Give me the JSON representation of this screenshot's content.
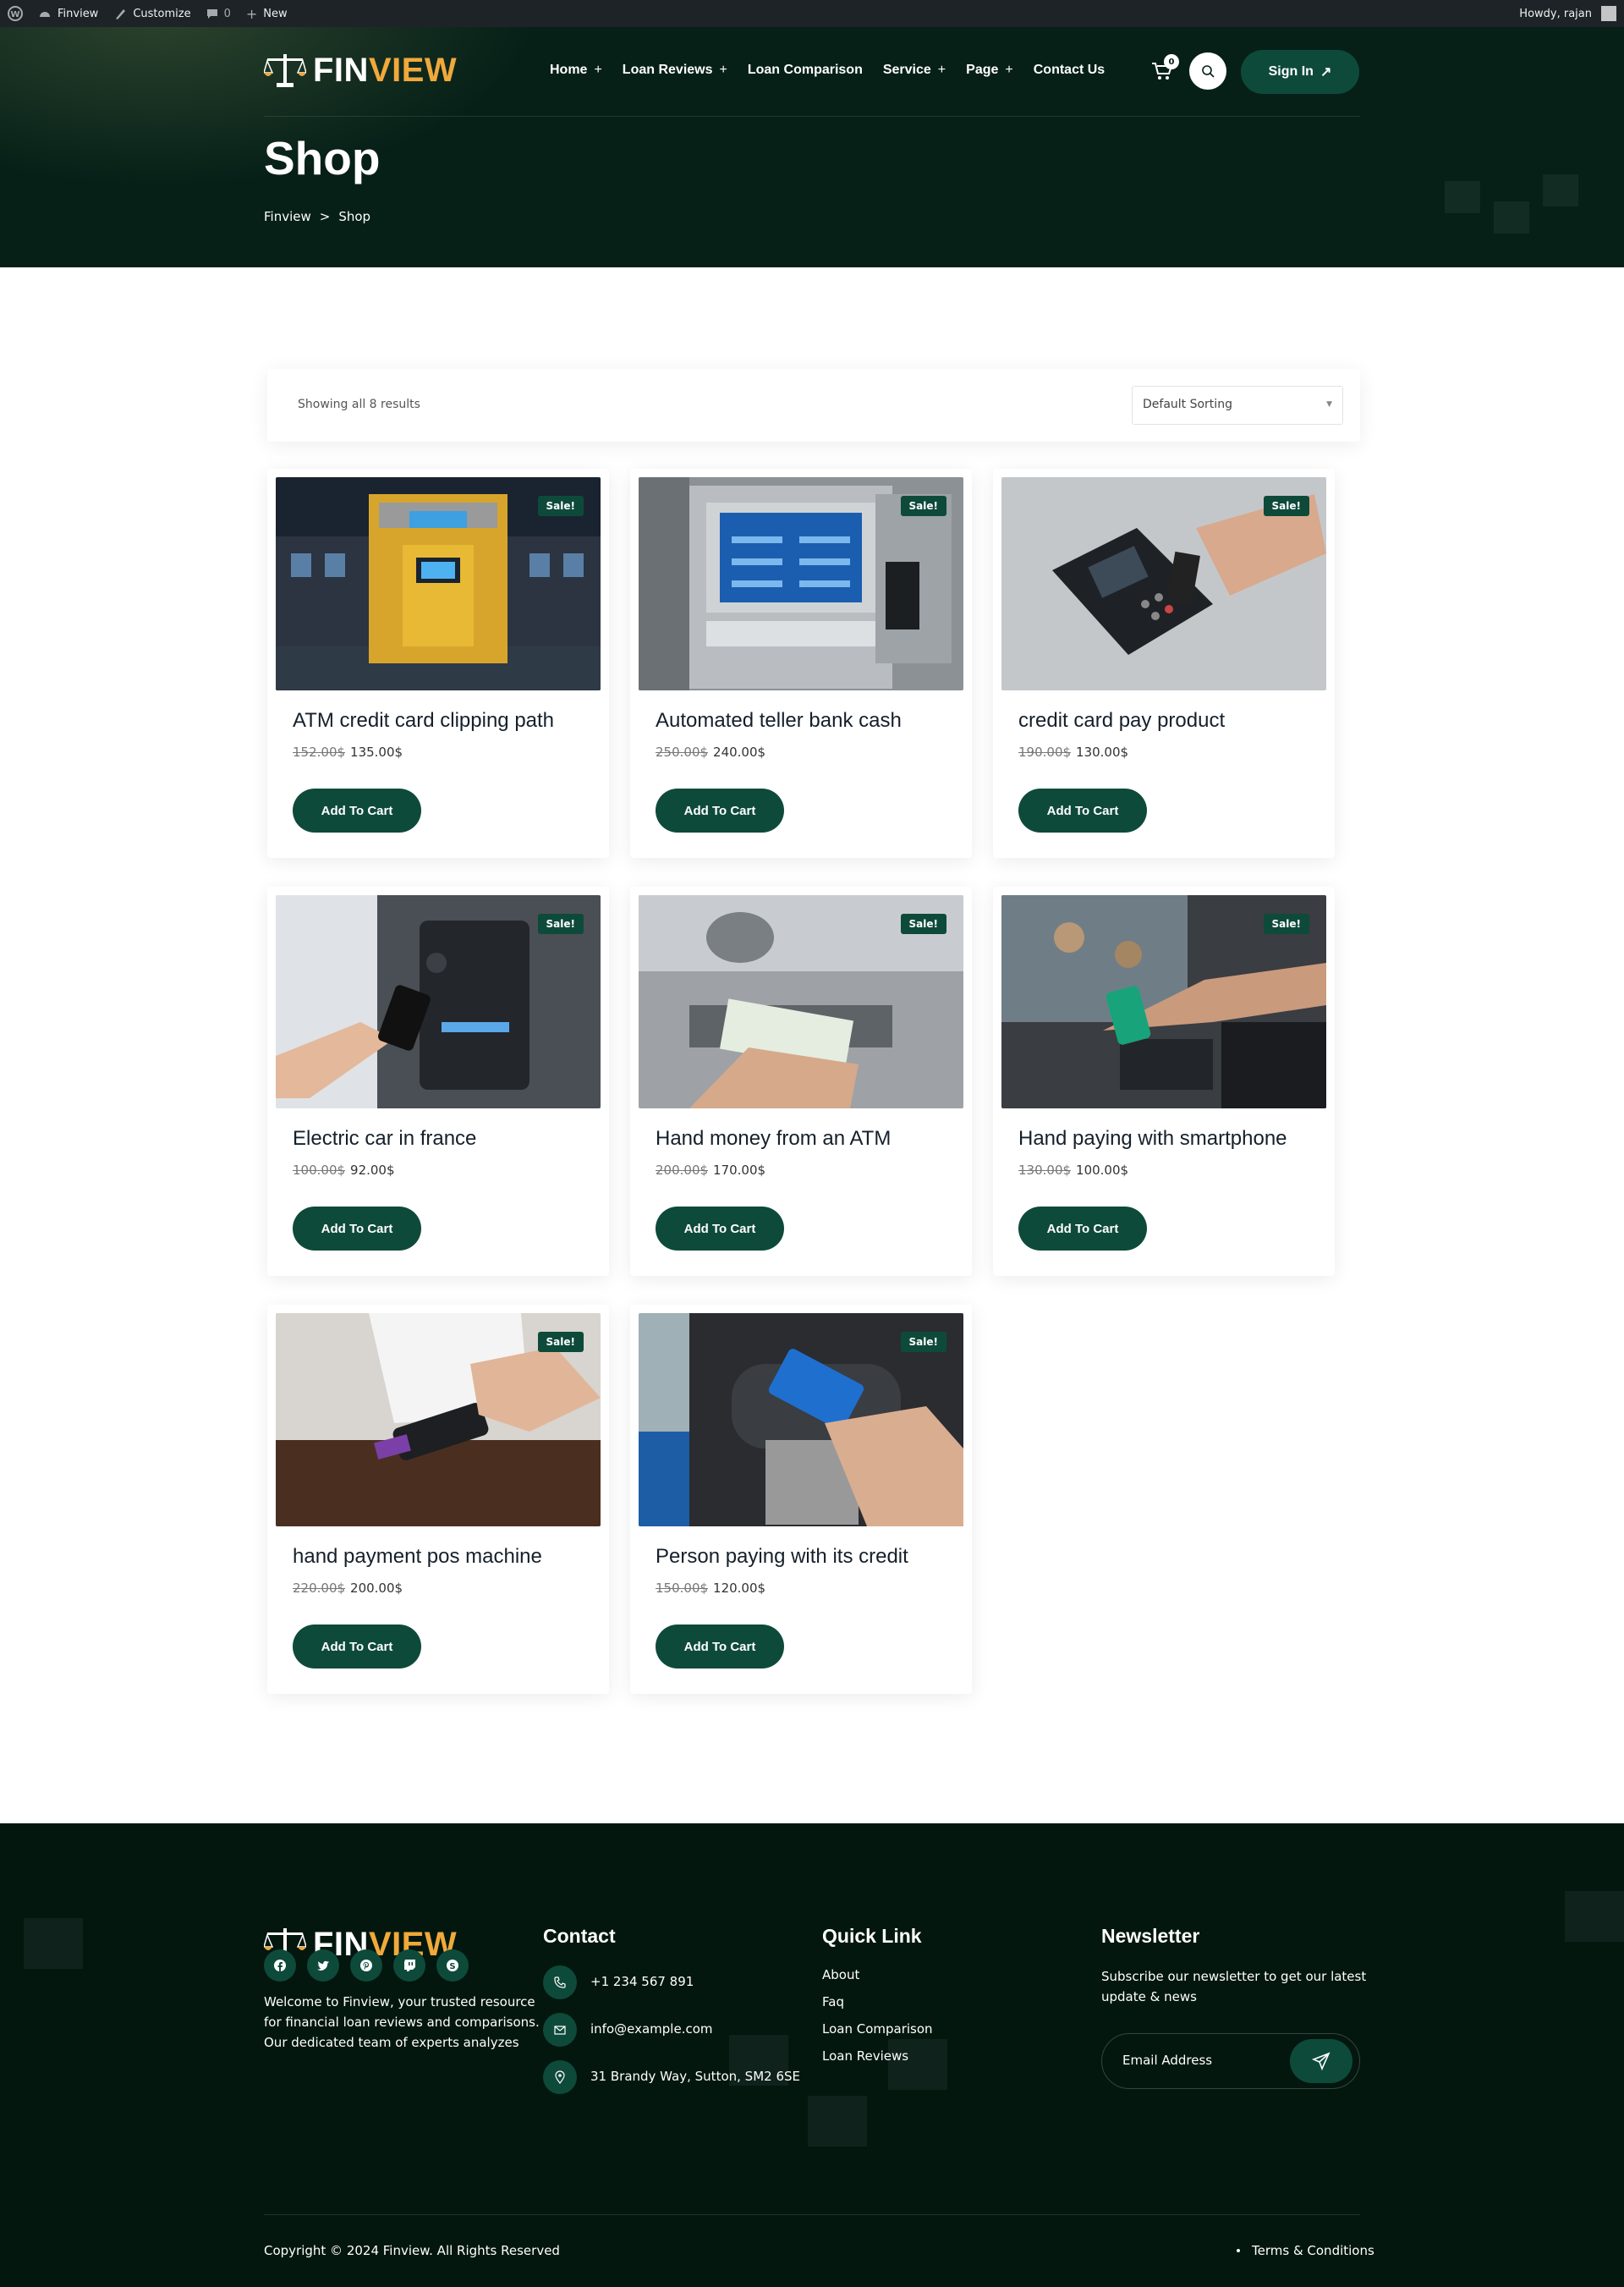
{
  "admin_bar": {
    "site_name": "Finview",
    "customize_label": "Customize",
    "comments_count": "0",
    "new_label": "New",
    "greeting": "Howdy, rajan"
  },
  "header": {
    "logo_part1": "FIN",
    "logo_part2": "VIEW",
    "nav": [
      {
        "label": "Home",
        "plus": "+"
      },
      {
        "label": "Loan Reviews",
        "plus": "+"
      },
      {
        "label": "Loan Comparison",
        "plus": ""
      },
      {
        "label": "Service",
        "plus": "+"
      },
      {
        "label": "Page",
        "plus": "+"
      },
      {
        "label": "Contact Us",
        "plus": ""
      }
    ],
    "cart_count": "0",
    "signin_label": "Sign In",
    "signin_arrow": "↗"
  },
  "hero": {
    "title": "Shop",
    "breadcrumb_home": "Finview",
    "breadcrumb_sep": ">",
    "breadcrumb_current": "Shop"
  },
  "shop": {
    "results_text": "Showing all 8 results",
    "sorting_value": "Default Sorting",
    "sale_badge": "Sale!",
    "add_to_cart_label": "Add To Cart",
    "products": [
      {
        "name": "ATM credit card clipping path",
        "old_price": "152.00$",
        "price": "135.00$",
        "image": "atm-yellow-kiosk"
      },
      {
        "name": "Automated teller bank cash",
        "old_price": "250.00$",
        "price": "240.00$",
        "image": "atm-screen-closeup"
      },
      {
        "name": "credit card pay product",
        "old_price": "190.00$",
        "price": "130.00$",
        "image": "card-pos-terminal"
      },
      {
        "name": "Electric car in france",
        "old_price": "100.00$",
        "price": "92.00$",
        "image": "phone-nfc-reader"
      },
      {
        "name": "Hand money from an ATM",
        "old_price": "200.00$",
        "price": "170.00$",
        "image": "cash-from-atm"
      },
      {
        "name": "Hand paying with smartphone",
        "old_price": "130.00$",
        "price": "100.00$",
        "image": "smartphone-payment"
      },
      {
        "name": "hand payment pos machine",
        "old_price": "220.00$",
        "price": "200.00$",
        "image": "pos-machine-counter"
      },
      {
        "name": "Person paying with its credit",
        "old_price": "150.00$",
        "price": "120.00$",
        "image": "card-at-keypad"
      }
    ]
  },
  "footer": {
    "logo_part1": "FIN",
    "logo_part2": "VIEW",
    "about_lines": [
      "Welcome to Finview, your trusted resource",
      "for financial loan reviews and comparisons.",
      "Our dedicated team of experts analyzes"
    ],
    "social_icons": [
      "facebook-icon",
      "twitter-icon",
      "pinterest-icon",
      "twitch-icon",
      "skype-icon"
    ],
    "contact_heading": "Contact",
    "phone": "+1 234 567 891",
    "email": "info@example.com",
    "address": "31 Brandy Way, Sutton, SM2 6SE",
    "quick_link_heading": "Quick Link",
    "quick_links": [
      "About",
      "Faq",
      "Loan Comparison",
      "Loan Reviews"
    ],
    "newsletter_heading": "Newsletter",
    "newsletter_lines": [
      "Subscribe our newsletter to get our latest",
      "update & news"
    ],
    "email_placeholder": "Email Address",
    "copyright": "Copyright © 2024 Finview. All Rights Reserved",
    "terms": "Terms & Conditions"
  },
  "colors": {
    "brand_dark": "#062018",
    "brand_green": "#0e4a3a",
    "logo_accent": "#f0a93b",
    "footer_bg": "#03170f"
  }
}
